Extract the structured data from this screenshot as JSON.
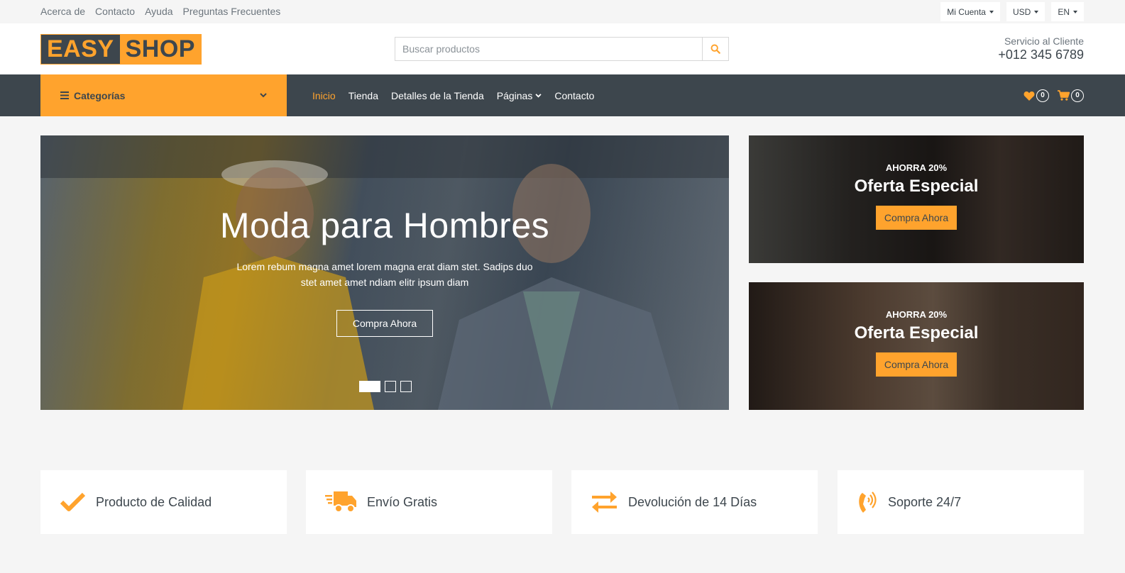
{
  "topbar": {
    "links": [
      "Acerca de",
      "Contacto",
      "Ayuda",
      "Preguntas Frecuentes"
    ],
    "account_label": "Mi Cuenta",
    "currency_label": "USD",
    "language_label": "EN"
  },
  "header": {
    "logo_part1": "EASY",
    "logo_part2": "SHOP",
    "search_placeholder": "Buscar productos",
    "service_label": "Servicio al Cliente",
    "service_phone": "+012 345 6789"
  },
  "navbar": {
    "categories_label": "Categorías",
    "links": [
      "Inicio",
      "Tienda",
      "Detalles de la Tienda",
      "Páginas",
      "Contacto"
    ],
    "wishlist_count": "0",
    "cart_count": "0"
  },
  "carousel": {
    "title": "Moda para Hombres",
    "text": "Lorem rebum magna amet lorem magna erat diam stet. Sadips duo stet amet amet ndiam elitr ipsum diam",
    "button": "Compra Ahora",
    "slides": 3,
    "active_slide": 1
  },
  "offers": [
    {
      "pre": "AHORRA 20%",
      "title": "Oferta Especial",
      "button": "Compra Ahora"
    },
    {
      "pre": "AHORRA 20%",
      "title": "Oferta Especial",
      "button": "Compra Ahora"
    }
  ],
  "features": [
    {
      "icon": "check-icon",
      "label": "Producto de Calidad"
    },
    {
      "icon": "shipping-truck-icon",
      "label": "Envío Gratis"
    },
    {
      "icon": "exchange-arrows-icon",
      "label": "Devolución de 14 Días"
    },
    {
      "icon": "phone-volume-icon",
      "label": "Soporte 24/7"
    }
  ],
  "colors": {
    "accent": "#ffa32d",
    "dark": "#3d464d",
    "light": "#f5f5f5"
  }
}
